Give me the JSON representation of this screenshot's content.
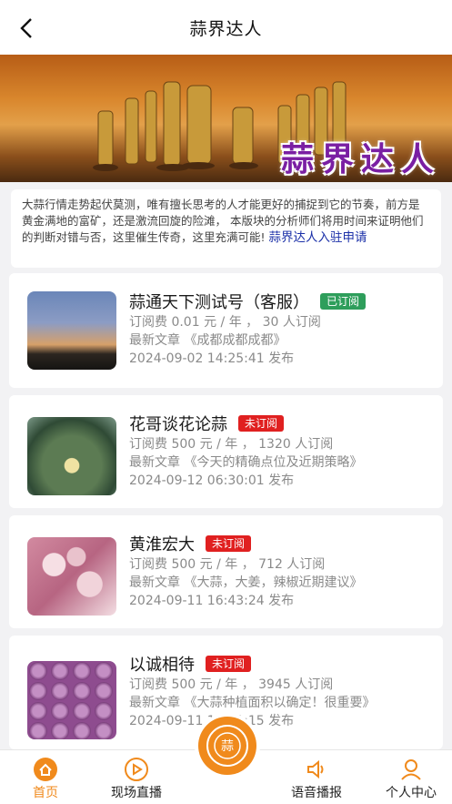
{
  "header": {
    "title": "蒜界达人"
  },
  "banner": {
    "text": "蒜界达人"
  },
  "intro": {
    "text": "大蒜行情走势起伏莫测，唯有擅长思考的人才能更好的捕捉到它的节奏，前方是黄金满地的富矿，还是激流回旋的险滩， 本版块的分析师们将用时间来证明他们的判断对错与否，这里催生传奇，这里充满可能!",
    "apply_link": "蒜界达人入驻申请"
  },
  "experts": [
    {
      "name": "蒜通天下测试号（客服）",
      "status": "已订阅",
      "status_color": "#2e9e5b",
      "fee": "订阅费 0.01 元 / 年 ， 30 人订阅",
      "latest": "最新文章 《成都成都成都》",
      "time": "2024-09-02 14:25:41 发布"
    },
    {
      "name": "花哥谈花论蒜",
      "status": "未订阅",
      "status_color": "#e02020",
      "fee": "订阅费 500 元 / 年 ， 1320 人订阅",
      "latest": "最新文章 《今天的精确点位及近期策略》",
      "time": "2024-09-12 06:30:01 发布"
    },
    {
      "name": "黄淮宏大",
      "status": "未订阅",
      "status_color": "#e02020",
      "fee": "订阅费 500 元 / 年 ， 712 人订阅",
      "latest": "最新文章 《大蒜，大姜，辣椒近期建议》",
      "time": "2024-09-11 16:43:24 发布"
    },
    {
      "name": "以诚相待",
      "status": "未订阅",
      "status_color": "#e02020",
      "fee": "订阅费 500 元 / 年 ， 3945 人订阅",
      "latest": "最新文章 《大蒜种植面积以确定！很重要》",
      "time": "2024-09-11 16:41:15 发布"
    }
  ],
  "tabs": [
    {
      "label": "首页",
      "active": true,
      "icon": "home-icon"
    },
    {
      "label": "现场直播",
      "active": false,
      "icon": "play-icon"
    },
    {
      "label": "蒜",
      "active": false,
      "icon": "center-logo-icon"
    },
    {
      "label": "语音播报",
      "active": false,
      "icon": "speaker-icon"
    },
    {
      "label": "个人中心",
      "active": false,
      "icon": "user-icon"
    }
  ],
  "colors": {
    "accent": "#f08a1c",
    "link": "#1a2fa8"
  }
}
